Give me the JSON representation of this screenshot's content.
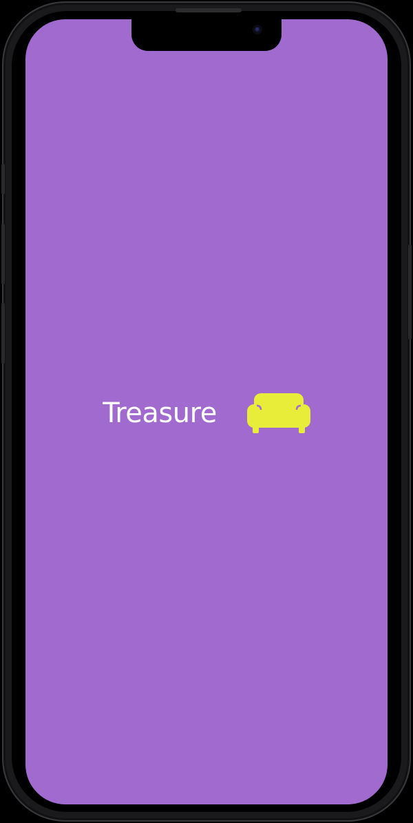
{
  "splash": {
    "app_name": "Treasure",
    "logo_icon": "sofa-icon"
  },
  "colors": {
    "background": "#a06acf",
    "title_text": "#ffffff",
    "logo": "#e8ed3a",
    "device_frame": "#1a1a1c"
  }
}
